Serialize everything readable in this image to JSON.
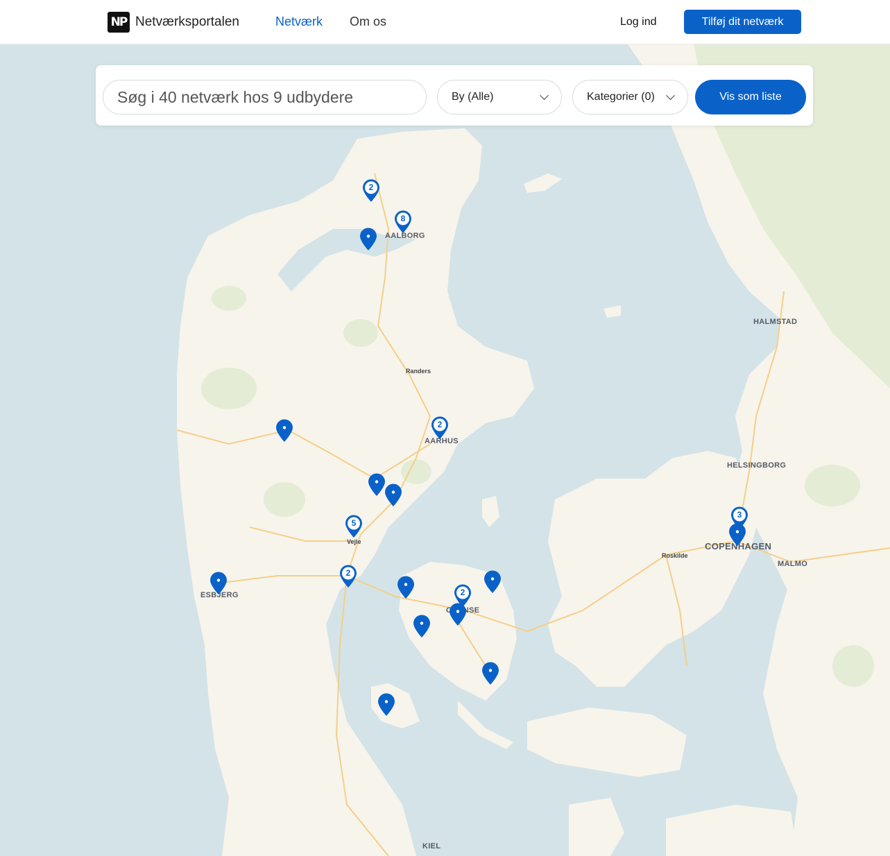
{
  "header": {
    "logo_mark": "NP",
    "brand": "Netværksportalen",
    "nav": [
      {
        "label": "Netværk",
        "active": true
      },
      {
        "label": "Om os",
        "active": false
      }
    ],
    "login": "Log ind",
    "cta": "Tilføj dit netværk"
  },
  "search": {
    "placeholder": "Søg i 40 netværk hos 9 udbydere",
    "city_select": "By (Alle)",
    "category_select": "Kategorier (0)",
    "list_button": "Vis som liste"
  },
  "map": {
    "colors": {
      "water": "#d4e3e8",
      "land": "#f7f4ec",
      "forest": "#e4ecd6",
      "road": "#f5cf86",
      "accent": "#0a62c9"
    },
    "cities": [
      {
        "id": "aalborg",
        "label": "AALBORG"
      },
      {
        "id": "halmstad",
        "label": "HALMSTAD"
      },
      {
        "id": "randers",
        "label": "Randers"
      },
      {
        "id": "aarhus",
        "label": "AARHUS"
      },
      {
        "id": "helsingborg",
        "label": "HELSINGBORG"
      },
      {
        "id": "vejle",
        "label": "Vejle"
      },
      {
        "id": "roskilde",
        "label": "Roskilde"
      },
      {
        "id": "copenhagen",
        "label": "COPENHAGEN"
      },
      {
        "id": "malmo",
        "label": "MALMO"
      },
      {
        "id": "esbjerg",
        "label": "ESBJERG"
      },
      {
        "id": "odense",
        "label": "ODENSE"
      },
      {
        "id": "kiel",
        "label": "KIEL"
      }
    ],
    "markers": [
      {
        "id": "m1",
        "count": "2"
      },
      {
        "id": "m2",
        "count": "8"
      },
      {
        "id": "m3",
        "count": ""
      },
      {
        "id": "m4",
        "count": ""
      },
      {
        "id": "m5",
        "count": "2"
      },
      {
        "id": "m6",
        "count": ""
      },
      {
        "id": "m7",
        "count": ""
      },
      {
        "id": "m8",
        "count": "5"
      },
      {
        "id": "m9",
        "count": "3"
      },
      {
        "id": "m10",
        "count": ""
      },
      {
        "id": "m11",
        "count": ""
      },
      {
        "id": "m12",
        "count": "2"
      },
      {
        "id": "m13",
        "count": ""
      },
      {
        "id": "m14",
        "count": ""
      },
      {
        "id": "m15",
        "count": "2"
      },
      {
        "id": "m16",
        "count": ""
      },
      {
        "id": "m17",
        "count": ""
      },
      {
        "id": "m18",
        "count": ""
      },
      {
        "id": "m19",
        "count": ""
      }
    ]
  }
}
